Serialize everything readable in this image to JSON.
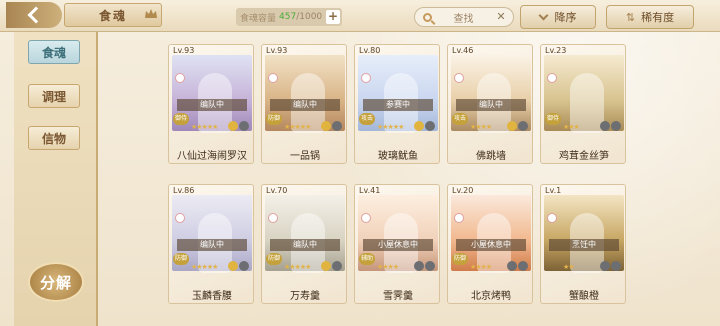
{
  "header": {
    "title": "食魂",
    "capacity_label": "食魂容量",
    "capacity_current": "457",
    "capacity_max": "/1000",
    "search_label": "查找",
    "sort_desc_label": "降序",
    "sort_rarity_label": "稀有度"
  },
  "sidebar": {
    "tabs": [
      {
        "label": "食魂",
        "active": true
      },
      {
        "label": "调理",
        "active": false
      },
      {
        "label": "信物",
        "active": false
      }
    ],
    "decompose_label": "分解"
  },
  "cards": [
    {
      "level": "Lv.93",
      "status": "编队中",
      "type": "御侍",
      "name": "八仙过海闹罗汉"
    },
    {
      "level": "Lv.93",
      "status": "编队中",
      "type": "防御",
      "name": "一品锅"
    },
    {
      "level": "Lv.80",
      "status": "参赛中",
      "type": "攻击",
      "name": "玻璃鱿鱼"
    },
    {
      "level": "Lv.46",
      "status": "编队中",
      "type": "攻击",
      "name": "佛跳墙"
    },
    {
      "level": "Lv.23",
      "status": "",
      "type": "御侍",
      "name": "鸡茸金丝笋"
    },
    {
      "level": "Lv.86",
      "status": "编队中",
      "type": "防御",
      "name": "玉麟香腰"
    },
    {
      "level": "Lv.70",
      "status": "编队中",
      "type": "防御",
      "name": "万寿羹"
    },
    {
      "level": "Lv.41",
      "status": "小屋休息中",
      "type": "辅助",
      "name": "雪霁羹"
    },
    {
      "level": "Lv.20",
      "status": "小屋休息中",
      "type": "防御",
      "name": "北京烤鸭"
    },
    {
      "level": "Lv.1",
      "status": "烹饪中",
      "type": "",
      "name": "蟹酿橙"
    }
  ],
  "colors": {
    "accent": "#c7a66f",
    "active_tab": "#3c6f7a",
    "capacity_current": "#4bab3a"
  }
}
